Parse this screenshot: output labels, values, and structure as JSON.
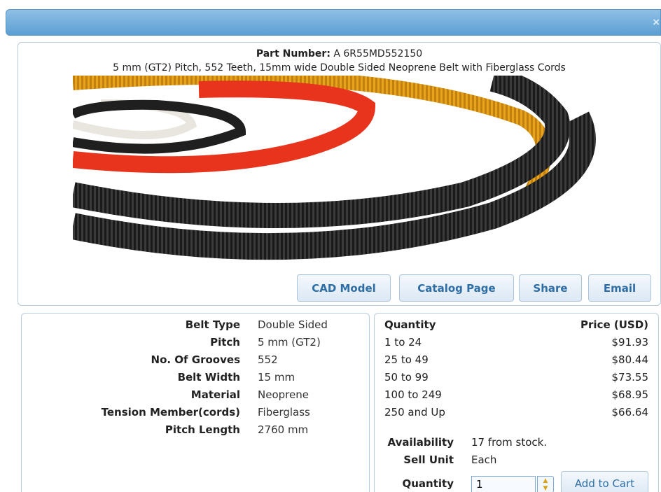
{
  "dialog": {
    "close_glyph": "×"
  },
  "product": {
    "part_number_label": "Part Number:",
    "part_number": "A 6R55MD552150",
    "description": "5 mm (GT2) Pitch, 552 Teeth, 15mm wide Double Sided Neoprene Belt with Fiberglass Cords"
  },
  "buttons": {
    "cad_model": "CAD Model",
    "catalog_page": "Catalog Page",
    "share": "Share",
    "email": "Email",
    "add_to_cart": "Add to Cart"
  },
  "specs": [
    {
      "label": "Belt Type",
      "value": "Double Sided"
    },
    {
      "label": "Pitch",
      "value": "5 mm (GT2)"
    },
    {
      "label": "No. Of Grooves",
      "value": "552"
    },
    {
      "label": "Belt Width",
      "value": "15 mm"
    },
    {
      "label": "Material",
      "value": "Neoprene"
    },
    {
      "label": "Tension Member(cords)",
      "value": "Fiberglass"
    },
    {
      "label": "Pitch Length",
      "value": "2760 mm"
    }
  ],
  "pricing": {
    "header_qty": "Quantity",
    "header_price": "Price (USD)",
    "rows": [
      {
        "qty": "1 to 24",
        "price": "$91.93"
      },
      {
        "qty": "25 to 49",
        "price": "$80.44"
      },
      {
        "qty": "50 to 99",
        "price": "$73.55"
      },
      {
        "qty": "100 to 249",
        "price": "$68.95"
      },
      {
        "qty": "250 and Up",
        "price": "$66.64"
      }
    ]
  },
  "order": {
    "availability_label": "Availability",
    "availability_value": "17 from stock.",
    "sell_unit_label": "Sell Unit",
    "sell_unit_value": "Each",
    "quantity_label": "Quantity",
    "quantity_value": "1"
  },
  "colors": {
    "titlebar": "#6aa8d9",
    "button_text": "#2e6ea6",
    "belt_red": "#e8341c",
    "belt_orange": "#e8a31c",
    "belt_black": "#1c1c1c"
  }
}
